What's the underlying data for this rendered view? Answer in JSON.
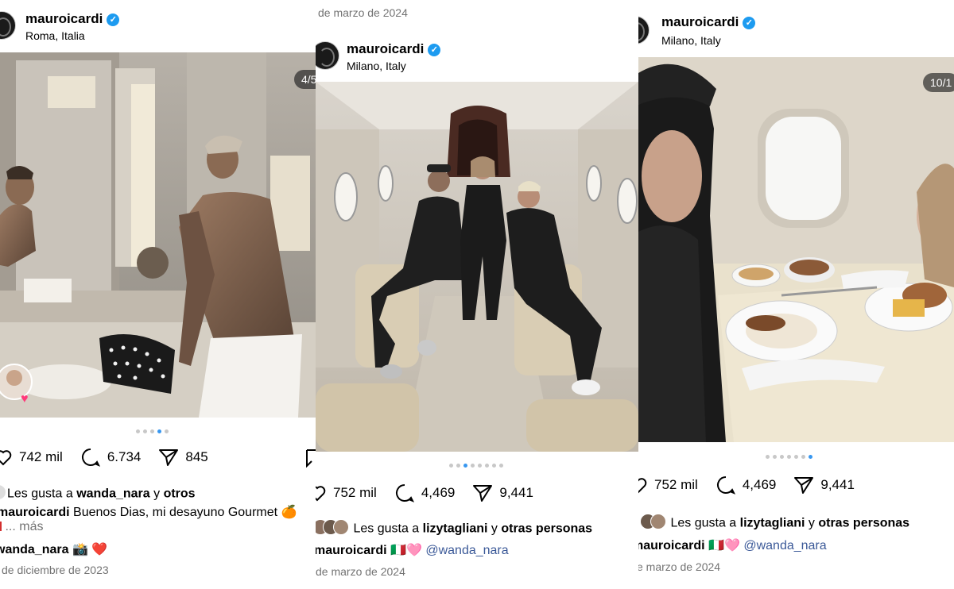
{
  "post1": {
    "username": "mauroicardi",
    "location": "Roma, Italia",
    "counter": "4/5",
    "likes": "742 mil",
    "comments": "6.734",
    "shares": "845",
    "liked_by_prefix": "Les gusta a",
    "liked_by_user": "wanda_nara",
    "liked_by_mid": "y",
    "liked_by_others": "otros",
    "caption_user": "mauroicardi",
    "caption_text": "Buenos Dias, mi desayuno Gourmet 🍊",
    "caption_more": "... más",
    "comment_user": "wanda_nara",
    "comment_text": "📸 ❤️",
    "date": "de diciembre de 2023"
  },
  "post2": {
    "top_date": "de marzo de 2024",
    "username": "mauroicardi",
    "location": "Milano, Italy",
    "likes": "752 mil",
    "comments": "4,469",
    "shares": "9,441",
    "liked_by_prefix": "Les gusta a",
    "liked_by_user": "lizytagliani",
    "liked_by_mid": "y",
    "liked_by_others": "otras personas",
    "caption_user": "mauroicardi",
    "caption_text": "🇮🇹🩷",
    "caption_mention": "@wanda_nara",
    "date": "de marzo de 2024"
  },
  "post3": {
    "username": "mauroicardi",
    "location": "Milano, Italy",
    "counter": "10/1",
    "likes": "752 mil",
    "comments": "4,469",
    "shares": "9,441",
    "liked_by_prefix": "Les gusta a",
    "liked_by_user": "lizytagliani",
    "liked_by_mid": "y",
    "liked_by_others": "otras personas",
    "caption_user": "mauroicardi",
    "caption_text": "🇮🇹🩷",
    "caption_mention": "@wanda_nara",
    "date": "e marzo de 2024"
  },
  "colors": {
    "active_dot": "#3897f0",
    "verified": "#1d9bf0",
    "mention": "#3b5998",
    "heart_badge": "#ff3a7a"
  }
}
